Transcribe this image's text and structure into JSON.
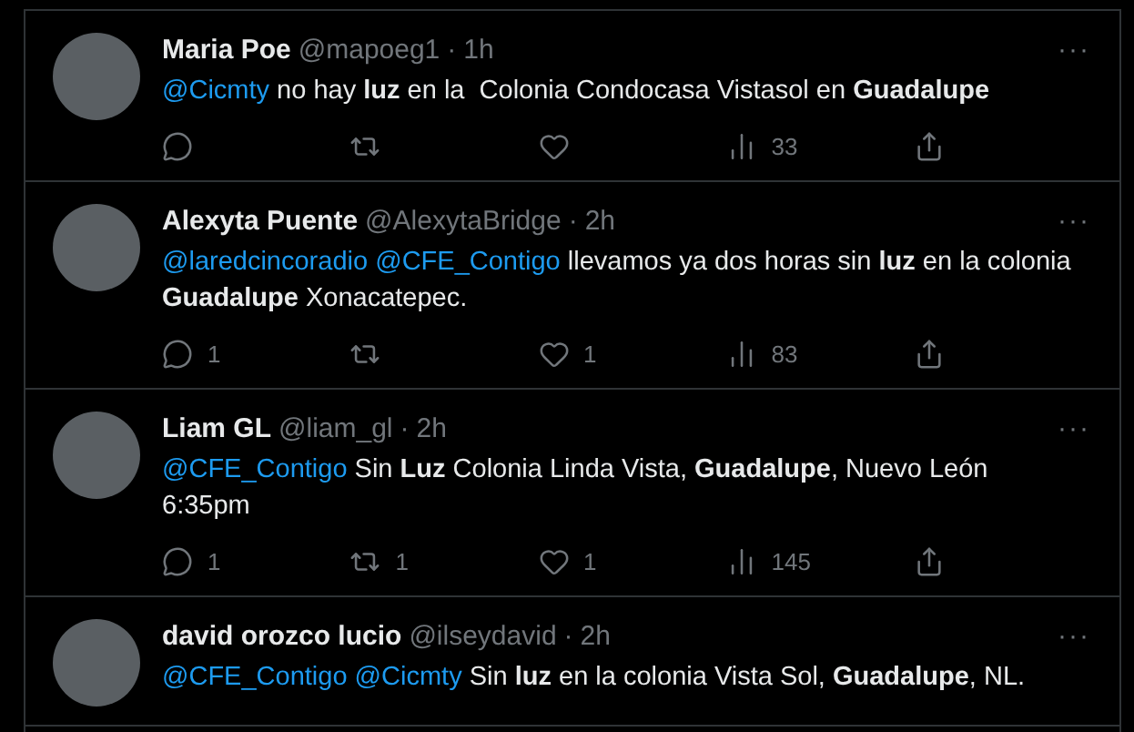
{
  "tweets": [
    {
      "name": "Maria Poe",
      "handle": "@mapoeg1",
      "sep": "·",
      "time": "1h",
      "more": "···",
      "body": [
        {
          "kind": "mention",
          "text": "@Cicmty"
        },
        {
          "kind": "text",
          "text": " no hay **luz** en la  Colonia Condocasa Vistasol en **Guadalupe**"
        }
      ],
      "stats": {
        "views": "33"
      }
    },
    {
      "name": "Alexyta Puente",
      "handle": "@AlexytaBridge",
      "sep": "·",
      "time": "2h",
      "more": "···",
      "body": [
        {
          "kind": "mention",
          "text": "@laredcincoradio"
        },
        {
          "kind": "mention",
          "text": "@CFE_Contigo"
        },
        {
          "kind": "text",
          "text": " llevamos ya dos horas sin **luz** en la colonia **Guadalupe** Xonacatepec."
        }
      ],
      "stats": {
        "replies": "1",
        "likes": "1",
        "views": "83"
      }
    },
    {
      "name": "Liam GL",
      "handle": "@liam_gl",
      "sep": "·",
      "time": "2h",
      "more": "···",
      "body": [
        {
          "kind": "mention",
          "text": "@CFE_Contigo"
        },
        {
          "kind": "text",
          "text": " Sin **Luz** Colonia Linda Vista, **Guadalupe**, Nuevo León 6:35pm"
        }
      ],
      "stats": {
        "replies": "1",
        "retweets": "1",
        "likes": "1",
        "views": "145"
      }
    },
    {
      "name": "david orozco lucio",
      "handle": "@ilseydavid",
      "sep": "·",
      "time": "2h",
      "more": "···",
      "body": [
        {
          "kind": "mention",
          "text": "@CFE_Contigo"
        },
        {
          "kind": "mention",
          "text": "@Cicmty"
        },
        {
          "kind": "text",
          "text": " Sin **luz** en la colonia Vista Sol, **Guadalupe**, NL."
        }
      ]
    }
  ]
}
